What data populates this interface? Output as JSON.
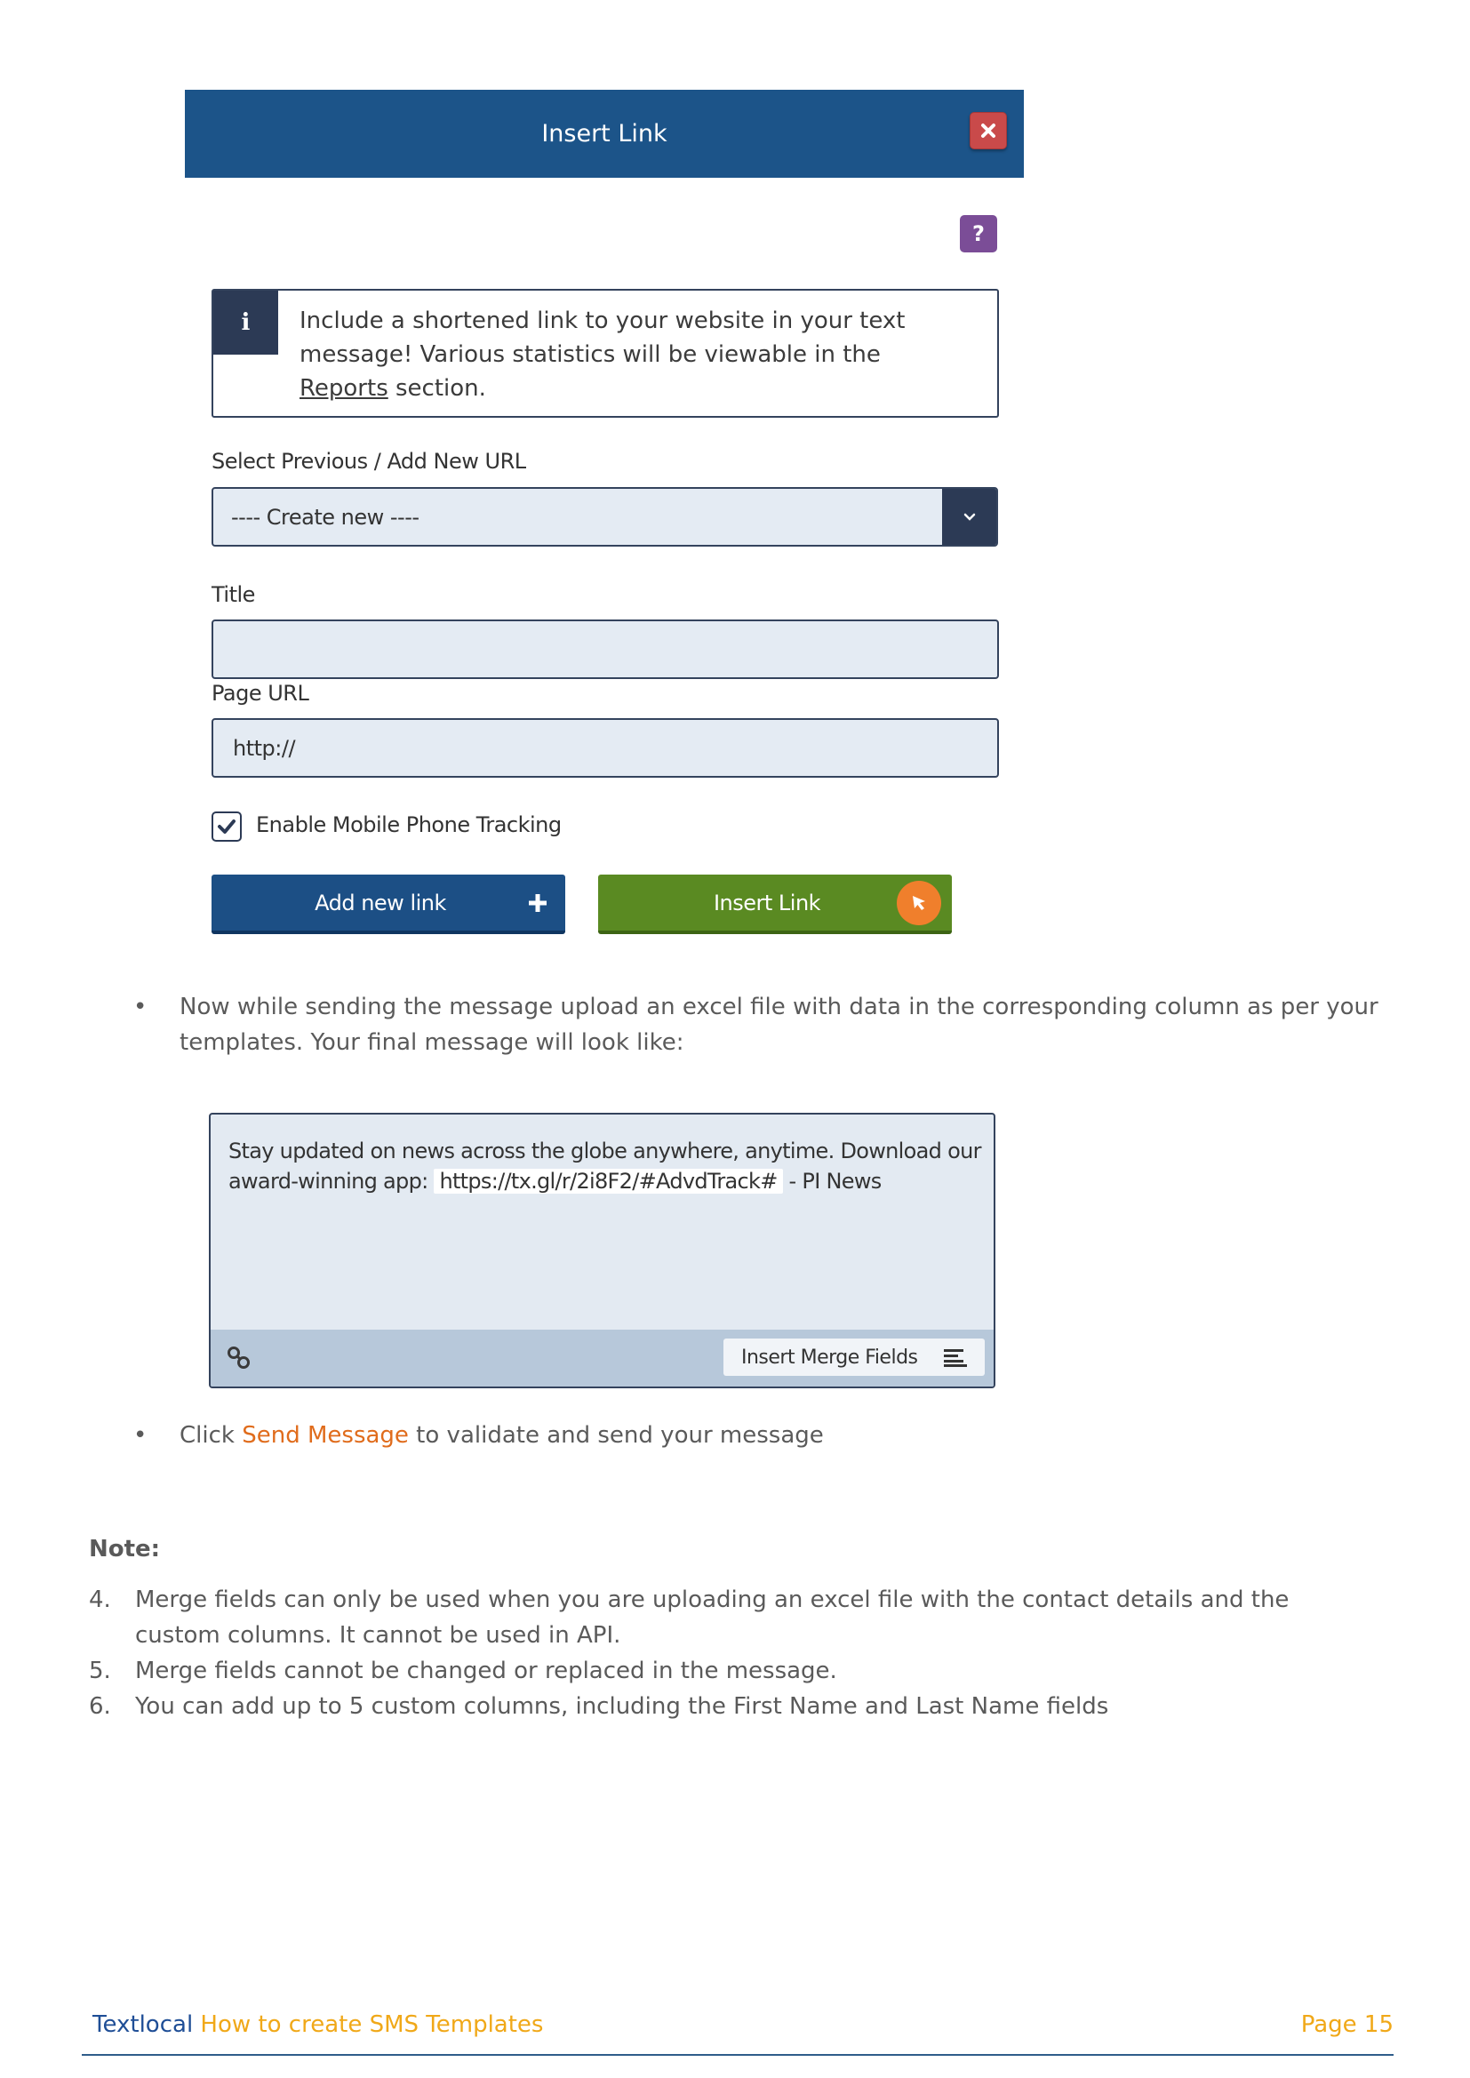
{
  "dialog": {
    "title": "Insert Link",
    "close_icon": "close-icon",
    "help_label": "?",
    "info": {
      "icon_label": "i",
      "text_before": "Include a shortened link to your website in your text message! Various statistics will be viewable in the ",
      "link_text": "Reports",
      "text_after": " section."
    },
    "select": {
      "label": "Select Previous / Add New URL",
      "value": "---- Create new ----"
    },
    "title_field": {
      "label": "Title",
      "value": ""
    },
    "url_field": {
      "label": "Page URL",
      "value": "http://"
    },
    "tracking": {
      "label": "Enable Mobile Phone Tracking",
      "checked": true
    },
    "add_button": "Add new link",
    "insert_button": "Insert Link",
    "colors": {
      "header": "#1c5489",
      "add_button": "#1c4f85",
      "insert_button": "#5a8a22",
      "close": "#c94a4a",
      "help": "#7b4d97",
      "cursor_badge": "#f07f2c"
    }
  },
  "bullets": [
    {
      "text": "Now while sending the message upload an excel file with data in the corresponding column as per your templates. Your final message will look like:"
    },
    {
      "prefix": "Click ",
      "highlight": "Send Message",
      "suffix": " to validate and send your message"
    }
  ],
  "message_preview": {
    "text_before": "Stay updated on news across the globe anywhere, anytime. Download our award-winning app: ",
    "link": "https://tx.gl/r/2i8F2/#AdvdTrack#",
    "text_after": " - PI News",
    "merge_button": "Insert Merge Fields"
  },
  "note": {
    "title": "Note:",
    "items": [
      {
        "num": "4.",
        "text": "Merge fields can only be used when you are uploading an excel file with the contact details and the custom columns. It cannot be used in API."
      },
      {
        "num": "5.",
        "text": "Merge fields cannot be changed or replaced in the message."
      },
      {
        "num": "6.",
        "text": "You can add up to 5 custom columns, including the First Name and Last Name fields"
      }
    ]
  },
  "footer": {
    "brand": "Textlocal",
    "doc_title": " How to create SMS Templates",
    "page": "Page 15"
  }
}
